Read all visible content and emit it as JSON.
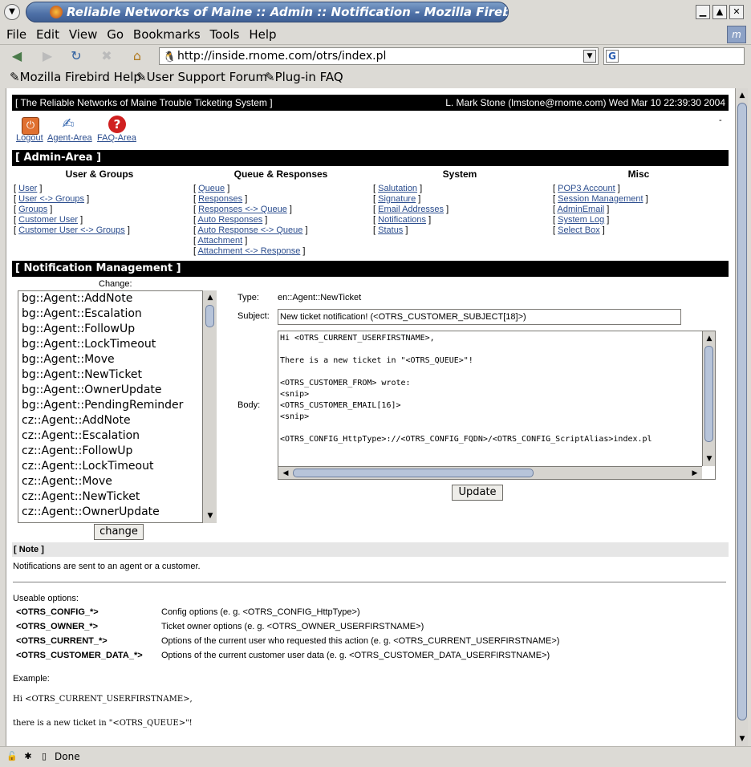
{
  "window": {
    "title": "Reliable Networks of Maine :: Admin :: Notification - Mozilla Firebird"
  },
  "menu": [
    "File",
    "Edit",
    "View",
    "Go",
    "Bookmarks",
    "Tools",
    "Help"
  ],
  "nav": {
    "url": "http://inside.rnome.com/otrs/index.pl"
  },
  "bookmarks": [
    "Mozilla Firebird Help",
    "User Support Forum",
    "Plug-in FAQ"
  ],
  "header": {
    "system": "[ The Reliable Networks of Maine Trouble Ticketing System ]",
    "user": "L. Mark Stone (lmstone@rnome.com) Wed Mar 10 22:39:30 2004",
    "dash": "-"
  },
  "toolbar": {
    "logout": "Logout",
    "agent": "Agent-Area",
    "faq": "FAQ-Area"
  },
  "admin": {
    "title": "[ Admin-Area ]",
    "columns": [
      {
        "head": "User & Groups",
        "links": [
          "User",
          "User <-> Groups",
          "Groups",
          "Customer User",
          "Customer User <-> Groups"
        ]
      },
      {
        "head": "Queue & Responses",
        "links": [
          "Queue",
          "Responses",
          "Responses <-> Queue",
          "Auto Responses",
          "Auto Response <-> Queue",
          "Attachment",
          "Attachment <-> Response"
        ]
      },
      {
        "head": "System",
        "links": [
          "Salutation",
          "Signature",
          "Email Addresses",
          "Notifications",
          "Status"
        ]
      },
      {
        "head": "Misc",
        "links": [
          "POP3 Account",
          "Session Management",
          "AdminEmail",
          "System Log",
          "Select Box"
        ]
      }
    ]
  },
  "notif": {
    "title": "[ Notification Management ]",
    "change_label": "Change:",
    "list": [
      "bg::Agent::AddNote",
      "bg::Agent::Escalation",
      "bg::Agent::FollowUp",
      "bg::Agent::LockTimeout",
      "bg::Agent::Move",
      "bg::Agent::NewTicket",
      "bg::Agent::OwnerUpdate",
      "bg::Agent::PendingReminder",
      "cz::Agent::AddNote",
      "cz::Agent::Escalation",
      "cz::Agent::FollowUp",
      "cz::Agent::LockTimeout",
      "cz::Agent::Move",
      "cz::Agent::NewTicket",
      "cz::Agent::OwnerUpdate"
    ],
    "change_button": "change",
    "type_label": "Type:",
    "type_value": "en::Agent::NewTicket",
    "subject_label": "Subject:",
    "subject_value": "New ticket notification! (<OTRS_CUSTOMER_SUBJECT[18]>)",
    "body_label": "Body:",
    "body_value": "Hi <OTRS_CURRENT_USERFIRSTNAME>,\n\nThere is a new ticket in \"<OTRS_QUEUE>\"!\n\n<OTRS_CUSTOMER_FROM> wrote:\n<snip>\n<OTRS_CUSTOMER_EMAIL[16]>\n<snip>\n\n<OTRS_CONFIG_HttpType>://<OTRS_CONFIG_FQDN>/<OTRS_CONFIG_ScriptAlias>index.pl",
    "update_button": "Update"
  },
  "note": {
    "title": "[ Note ]",
    "text": "Notifications are sent to an agent or a customer.",
    "useable": "Useable options:",
    "options": [
      {
        "key": "<OTRS_CONFIG_*>",
        "desc": "Config options (e. g. <OTRS_CONFIG_HttpType>)"
      },
      {
        "key": "<OTRS_OWNER_*>",
        "desc": "Ticket owner options (e. g. <OTRS_OWNER_USERFIRSTNAME>)"
      },
      {
        "key": "<OTRS_CURRENT_*>",
        "desc": "Options of the current user who requested this action (e. g. <OTRS_CURRENT_USERFIRSTNAME>)"
      },
      {
        "key": "<OTRS_CUSTOMER_DATA_*>",
        "desc": "Options of the current customer user data (e. g. <OTRS_CUSTOMER_DATA_USERFIRSTNAME>)"
      }
    ],
    "example_label": "Example:",
    "example_lines": [
      "Hi <OTRS_CURRENT_USERFIRSTNAME>,",
      "there is a new ticket in \"<OTRS_QUEUE>\"!"
    ]
  },
  "status": {
    "text": "Done"
  }
}
